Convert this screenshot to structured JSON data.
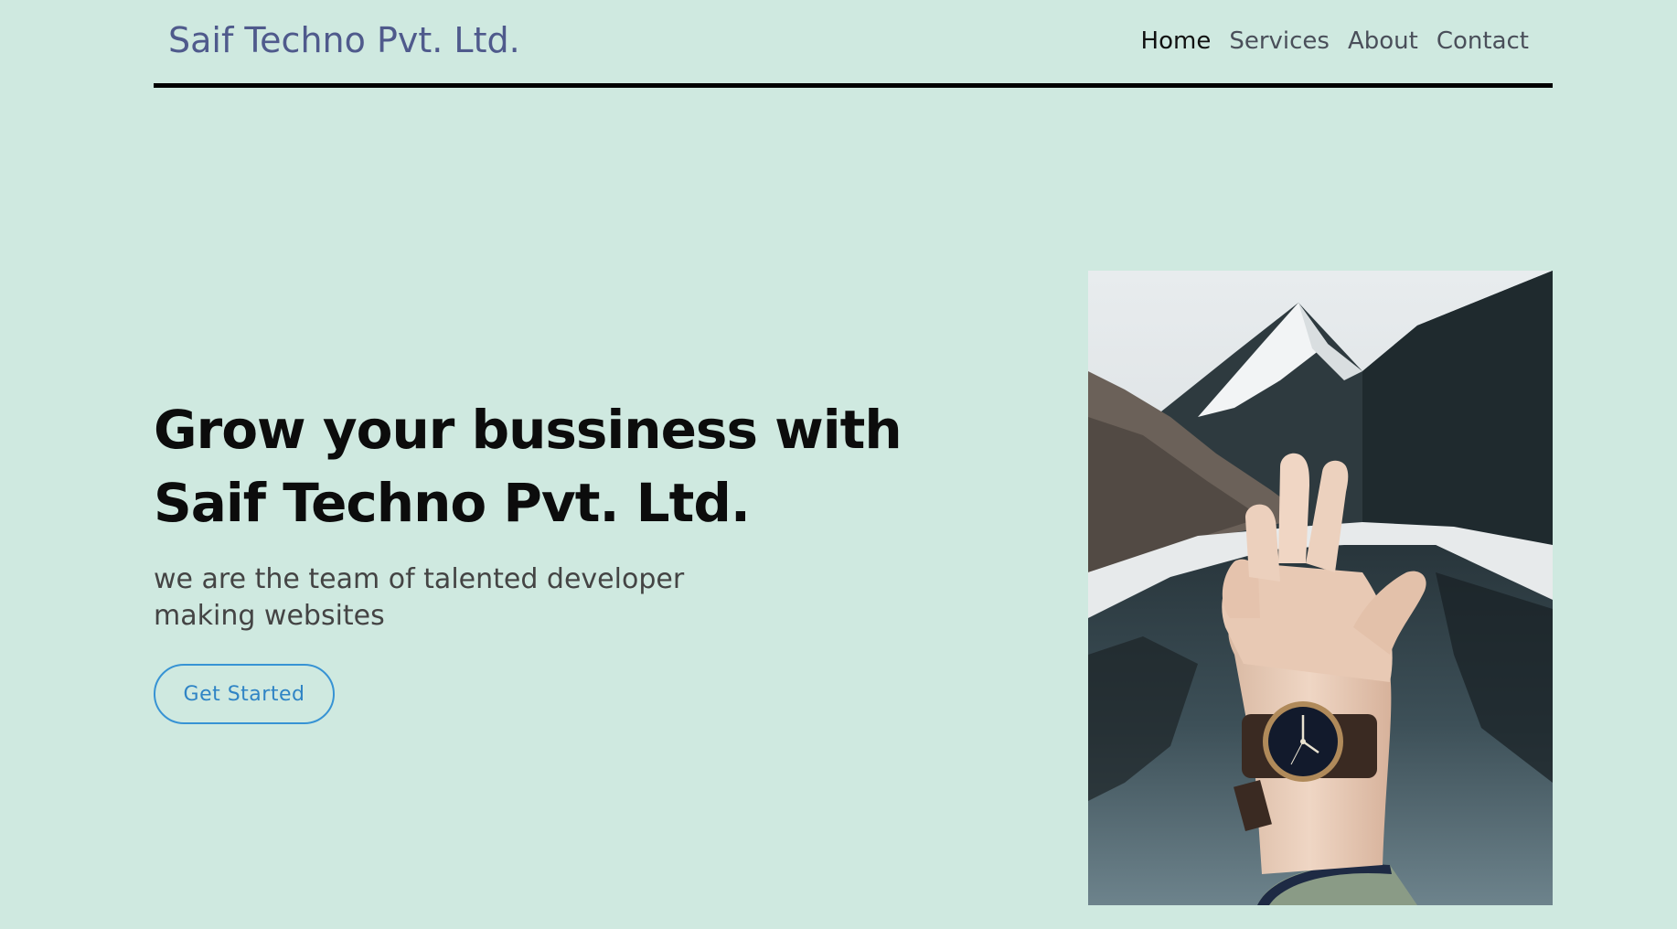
{
  "navbar": {
    "brand": "Saif Techno Pvt. Ltd.",
    "links": [
      {
        "label": "Home",
        "active": true
      },
      {
        "label": "Services",
        "active": false
      },
      {
        "label": "About",
        "active": false
      },
      {
        "label": "Contact",
        "active": false
      }
    ]
  },
  "hero": {
    "headline_line1": "Grow your bussiness with",
    "headline_line2": "Saif Techno Pvt. Ltd.",
    "subtext": "we are the team of talented developer making websites",
    "cta_label": "Get Started"
  },
  "colors": {
    "background": "#cfe9e0",
    "brand": "#4f5a8c",
    "accent": "#3793d4"
  }
}
